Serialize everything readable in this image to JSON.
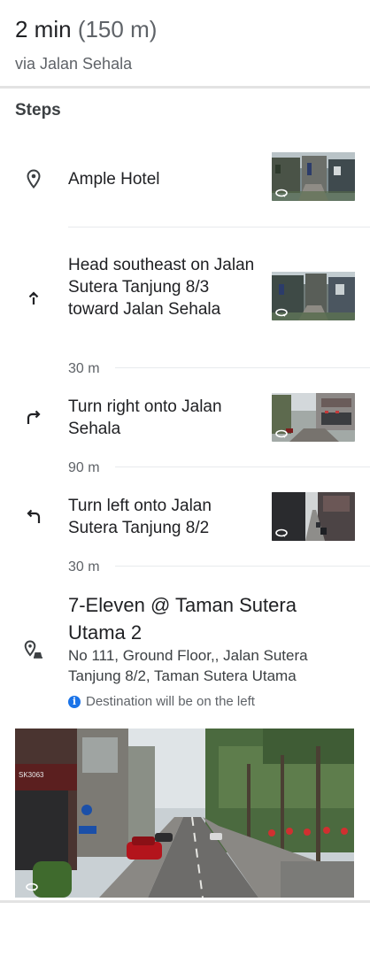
{
  "summary": {
    "duration": "2 min",
    "distance": "(150 m)",
    "via": "via Jalan Sehala"
  },
  "steps_title": "Steps",
  "steps": [
    {
      "icon": "location-pin-icon",
      "text": "Ample Hotel"
    },
    {
      "icon": "arrow-up-icon",
      "text": "Head southeast on Jalan Sutera Tanjung 8/3 toward Jalan Sehala",
      "distance_after": "30 m"
    },
    {
      "icon": "turn-right-icon",
      "text": "Turn right onto Jalan Sehala",
      "distance_after": "90 m"
    },
    {
      "icon": "turn-left-icon",
      "text": "Turn left onto Jalan Sutera Tanjung 8/2",
      "distance_after": "30 m"
    }
  ],
  "destination": {
    "icon": "destination-pin-icon",
    "name": "7-Eleven @ Taman Sutera Utama 2",
    "address": "No 111, Ground Floor,, Jalan Sutera Tanjung 8/2, Taman Sutera Utama",
    "note": "Destination will be on the left",
    "note_icon": "info-icon",
    "photo_sign": "SK3063"
  },
  "colors": {
    "accent": "#1a73e8",
    "text_primary": "#202124",
    "text_secondary": "#5f6368",
    "divider": "#e8eaed"
  }
}
